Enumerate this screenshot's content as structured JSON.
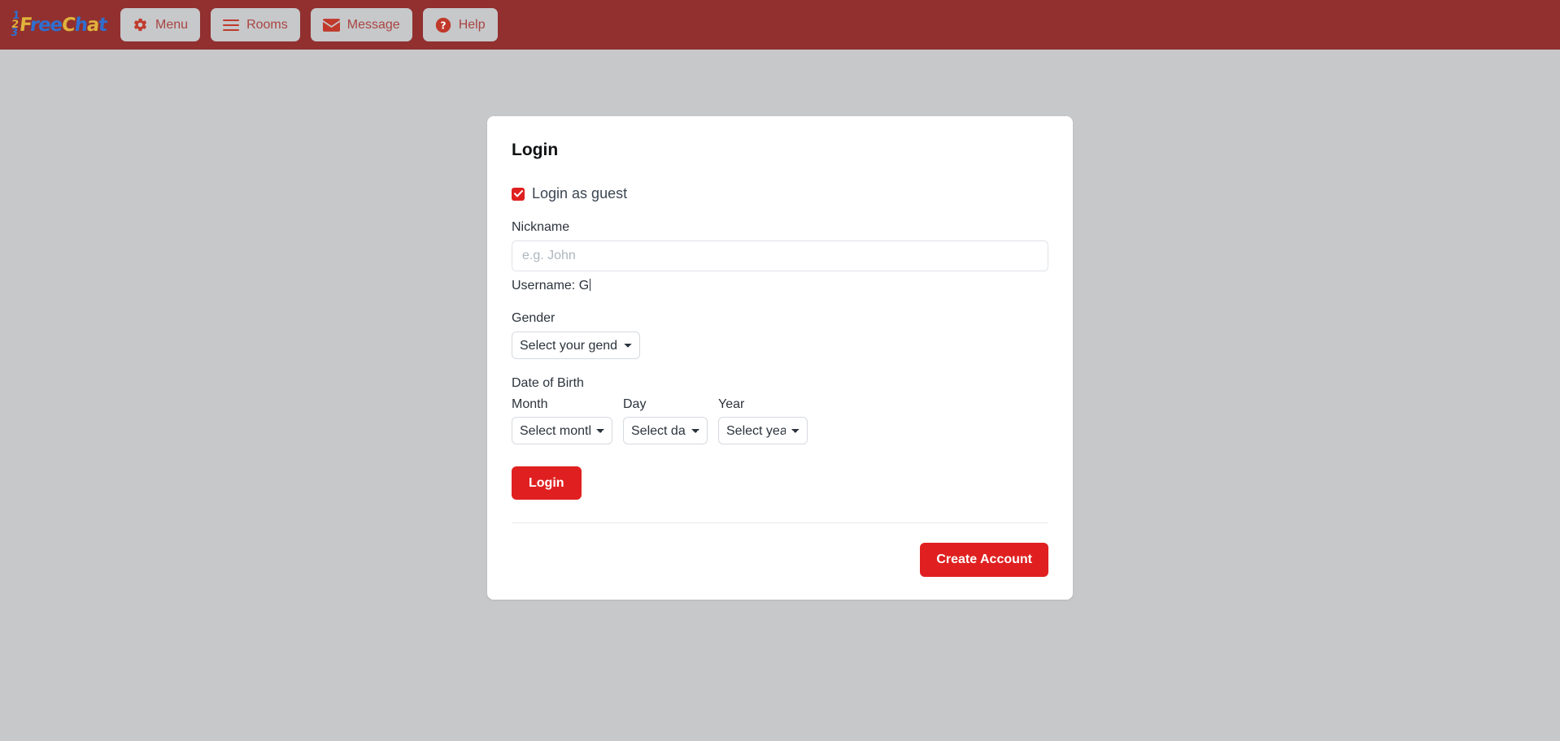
{
  "header": {
    "logo": {
      "digits": [
        "1",
        "2",
        "3"
      ],
      "word_parts": [
        {
          "text": "F",
          "color": "yellow"
        },
        {
          "text": "ree",
          "color": "blue"
        },
        {
          "text": "C",
          "color": "yellow"
        },
        {
          "text": "h",
          "color": "blue"
        },
        {
          "text": "a",
          "color": "yellow"
        },
        {
          "text": "t",
          "color": "blue"
        }
      ],
      "alt": "123FreeChat"
    },
    "nav": [
      {
        "label": "Menu",
        "icon": "gear-icon"
      },
      {
        "label": "Rooms",
        "icon": "hamburger-icon"
      },
      {
        "label": "Message",
        "icon": "envelope-icon"
      },
      {
        "label": "Help",
        "icon": "question-circle-icon"
      }
    ]
  },
  "login_card": {
    "title": "Login",
    "guest_checkbox": {
      "label": "Login as guest",
      "checked": true
    },
    "nickname": {
      "label": "Nickname",
      "value": "",
      "placeholder": "e.g. John"
    },
    "username_preview": "Username: G",
    "gender": {
      "label": "Gender",
      "selected": "Select your gender"
    },
    "date_of_birth": {
      "label": "Date of Birth",
      "month": {
        "label": "Month",
        "selected": "Select month"
      },
      "day": {
        "label": "Day",
        "selected": "Select day"
      },
      "year": {
        "label": "Year",
        "selected": "Select year"
      }
    },
    "login_button": "Login",
    "create_account_button": "Create Account"
  },
  "colors": {
    "header_bg": "#91302f",
    "page_bg": "#c6c8ca",
    "accent_red": "#e02020",
    "nav_text": "#a94442",
    "card_bg": "#ffffff"
  }
}
